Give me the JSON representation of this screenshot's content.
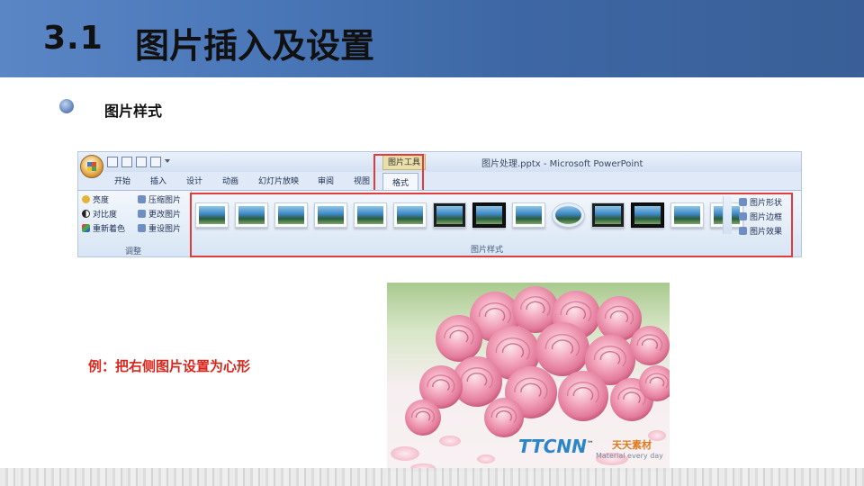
{
  "slide": {
    "number": "3.1",
    "title": "图片插入及设置",
    "bullet": "图片样式",
    "example": "例：把右侧图片设置为心形"
  },
  "ribbon": {
    "window_title": "图片处理.pptx - Microsoft PowerPoint",
    "contextual_tool": "图片工具",
    "tabs": [
      "开始",
      "插入",
      "设计",
      "动画",
      "幻灯片放映",
      "审阅",
      "视图",
      "格式"
    ],
    "active_tab": "格式",
    "adjust_group": {
      "caption": "调整",
      "commands": [
        "亮度",
        "对比度",
        "重新着色",
        "压缩图片",
        "更改图片",
        "重设图片"
      ]
    },
    "styles_group": {
      "caption": "图片样式",
      "thumbnail_count": 14,
      "side_commands": [
        "图片形状",
        "图片边框",
        "图片效果"
      ]
    }
  },
  "watermark": {
    "logo": "TTCNN",
    "tm": "™",
    "cn": "天天素材",
    "en": "Material every day"
  },
  "colors": {
    "header_blue": "#3d67a4",
    "highlight_red": "#e23b3b",
    "example_red": "#d9261c"
  }
}
